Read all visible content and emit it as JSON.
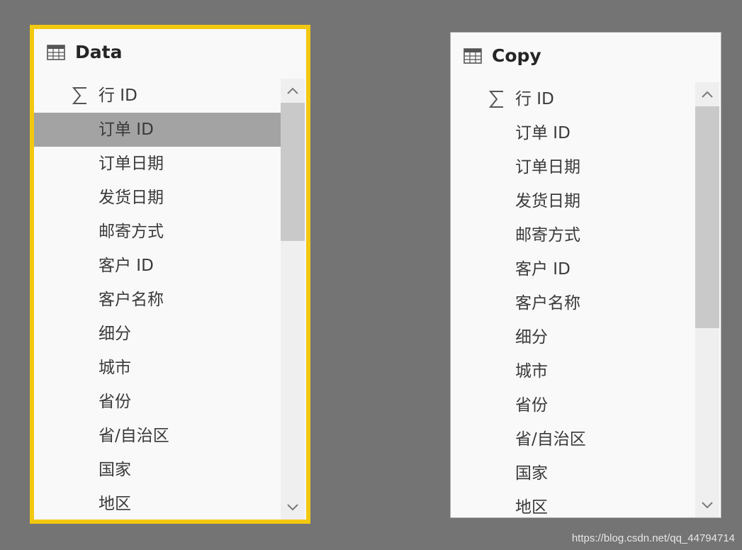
{
  "cards": [
    {
      "title": "Data",
      "selected": true,
      "fields": [
        {
          "label": "行 ID",
          "icon": "sigma-icon"
        },
        {
          "label": "订单 ID",
          "selected": true
        },
        {
          "label": "订单日期"
        },
        {
          "label": "发货日期"
        },
        {
          "label": "邮寄方式"
        },
        {
          "label": "客户 ID"
        },
        {
          "label": "客户名称"
        },
        {
          "label": "细分"
        },
        {
          "label": "城市"
        },
        {
          "label": "省份"
        },
        {
          "label": "省/自治区"
        },
        {
          "label": "国家"
        },
        {
          "label": "地区"
        }
      ]
    },
    {
      "title": "Copy",
      "selected": false,
      "fields": [
        {
          "label": "行 ID",
          "icon": "sigma-icon"
        },
        {
          "label": "订单 ID"
        },
        {
          "label": "订单日期"
        },
        {
          "label": "发货日期"
        },
        {
          "label": "邮寄方式"
        },
        {
          "label": "客户 ID"
        },
        {
          "label": "客户名称"
        },
        {
          "label": "细分"
        },
        {
          "label": "城市"
        },
        {
          "label": "省份"
        },
        {
          "label": "省/自治区"
        },
        {
          "label": "国家"
        },
        {
          "label": "地区"
        }
      ]
    }
  ],
  "icons": {
    "table": "table-icon",
    "measure": "sigma-icon",
    "scroll_up": "chevron-up-icon",
    "scroll_down": "chevron-down-icon"
  },
  "colors": {
    "canvas": "#747474",
    "selected_border": "#f2c811",
    "card_background": "#f9f9f9",
    "row_highlight": "#a3a3a3"
  },
  "watermark": "https://blog.csdn.net/qq_44794714"
}
